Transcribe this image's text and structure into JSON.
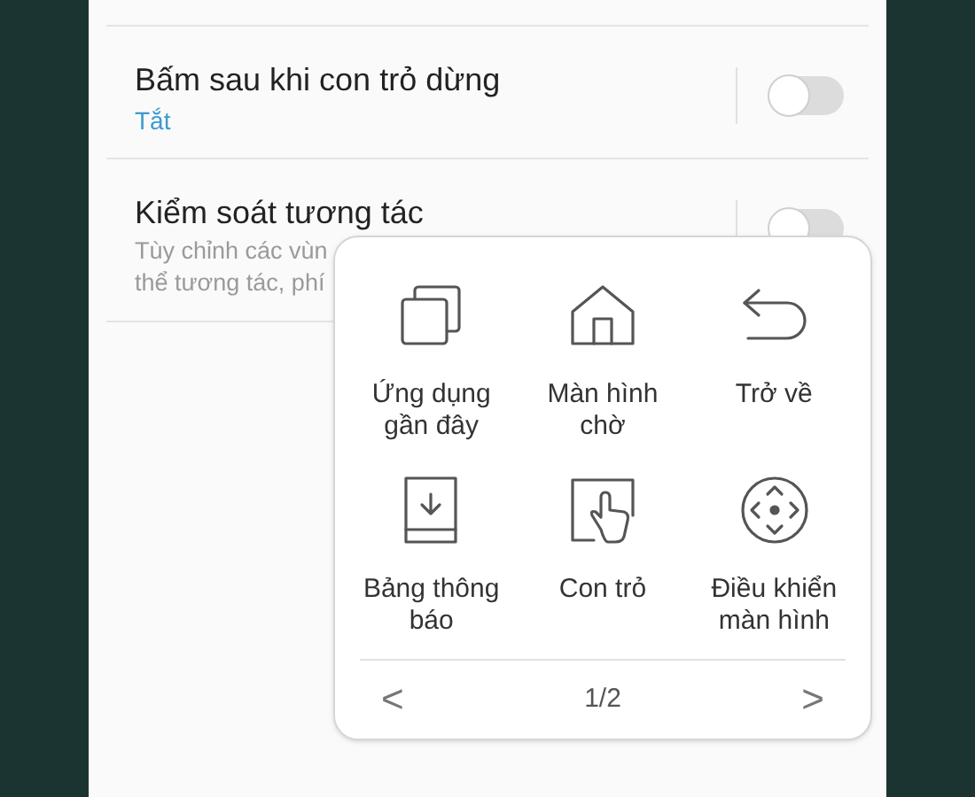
{
  "settings": [
    {
      "title": "Bấm sau khi con trỏ dừng",
      "summary": "Tắt",
      "kind": "status",
      "on": false
    },
    {
      "title": "Kiểm soát tương tác",
      "summary_lines": [
        "Tùy chỉnh các vùn",
        "thể tương tác, phí"
      ],
      "kind": "description",
      "on": false
    }
  ],
  "menu": {
    "items": [
      {
        "label": "Ứng dụng gần đây",
        "kind": "recent"
      },
      {
        "label": "Màn hình chờ",
        "kind": "home"
      },
      {
        "label": "Trở về",
        "kind": "back"
      },
      {
        "label": "Bảng thông báo",
        "kind": "notifications"
      },
      {
        "label": "Con trỏ",
        "kind": "pointer"
      },
      {
        "label": "Điều khiển màn hình",
        "kind": "screen"
      }
    ],
    "prev": "<",
    "page": "1/2",
    "next": ">"
  }
}
